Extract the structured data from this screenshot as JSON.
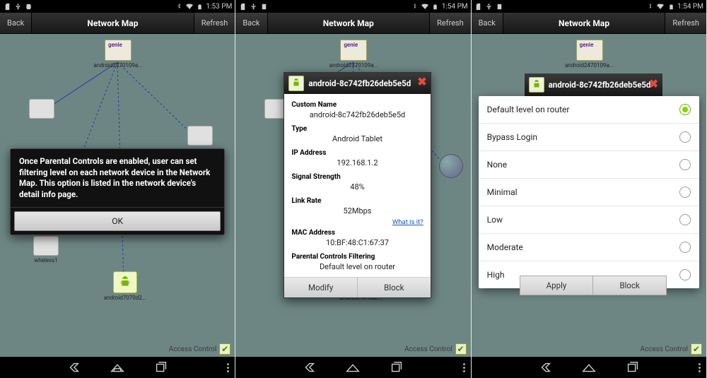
{
  "status": {
    "times": [
      "1:53 PM",
      "1:54 PM",
      "1:54 PM"
    ]
  },
  "header": {
    "back": "Back",
    "title": "Network Map",
    "refresh": "Refresh"
  },
  "access_control_label": "Access Control",
  "panel1_alert": {
    "message": "Once Parental Controls are enabled, user can set filtering level on each network device in the Network Map. This option is listed in the network device's detail info page.",
    "ok": "OK"
  },
  "device_labels": {
    "router": "android2470109a...",
    "tablet": "android7070d2..."
  },
  "panel2_dialog": {
    "title": "android-8c742fb26deb5e5d",
    "labels": {
      "custom_name": "Custom Name",
      "type": "Type",
      "ip": "IP Address",
      "signal": "Signal Strength",
      "linkrate": "Link Rate",
      "mac": "MAC Address",
      "pcf": "Parental Controls Filtering"
    },
    "values": {
      "custom_name": "android-8c742fb26deb5e5d",
      "type": "Android Tablet",
      "ip": "192.168.1.2",
      "signal": "48%",
      "linkrate": "52Mbps",
      "mac": "10:BF:48:C1:67:37",
      "pcf": "Default level on router"
    },
    "whatis": "What is it?",
    "buttons": {
      "modify": "Modify",
      "block": "Block"
    }
  },
  "panel3": {
    "title": "android-8c742fb26deb5e5d",
    "options": [
      "Default level on router",
      "Bypass Login",
      "None",
      "Minimal",
      "Low",
      "Moderate",
      "High"
    ],
    "selected_index": 0,
    "buttons": {
      "apply": "Apply",
      "block": "Block"
    }
  }
}
